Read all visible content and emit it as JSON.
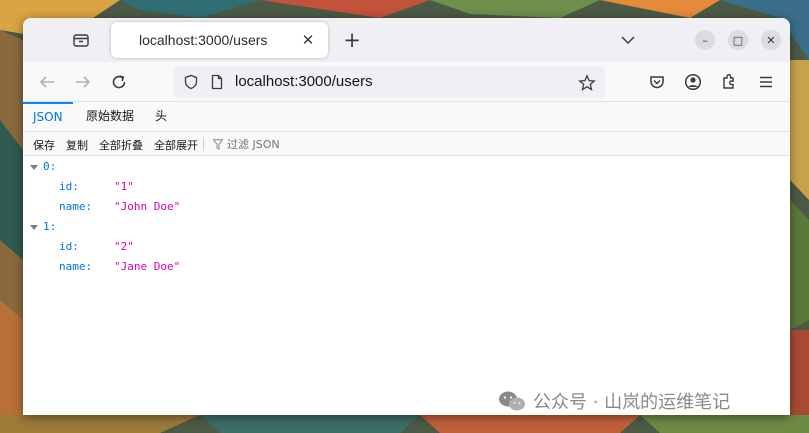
{
  "browser": {
    "tab_title": "localhost:3000/users",
    "new_tab_label": "+",
    "tab_close_label": "✕",
    "url": "localhost:3000/users",
    "window_controls": {
      "minimize": "–",
      "maximize": "□",
      "close": "✕"
    }
  },
  "viewer": {
    "tabs": [
      {
        "label": "JSON",
        "active": true
      },
      {
        "label": "原始数据",
        "active": false
      },
      {
        "label": "头",
        "active": false
      }
    ],
    "toolbar": {
      "save": "保存",
      "copy": "复制",
      "collapse_all": "全部折叠",
      "expand_all": "全部展开",
      "filter_placeholder": "过滤 JSON"
    },
    "tree": [
      {
        "index": "0:",
        "fields": [
          {
            "key": "id:",
            "value": "\"1\""
          },
          {
            "key": "name:",
            "value": "\"John Doe\""
          }
        ]
      },
      {
        "index": "1:",
        "fields": [
          {
            "key": "id:",
            "value": "\"2\""
          },
          {
            "key": "name:",
            "value": "\"Jane Doe\""
          }
        ]
      }
    ]
  },
  "watermark": {
    "text": "公众号 · 山岚的运维笔记"
  },
  "colors": {
    "accent": "#0a84ff",
    "json_key": "#0074e8",
    "json_string": "#dd00a9"
  },
  "icons": {
    "tab_list": "tab-list-icon",
    "back": "back-arrow-icon",
    "forward": "forward-arrow-icon",
    "reload": "reload-icon",
    "shield": "shield-icon",
    "page": "page-icon",
    "bookmark": "star-icon",
    "pocket": "pocket-icon",
    "account": "account-icon",
    "extensions": "puzzle-icon",
    "menu": "hamburger-menu-icon",
    "filter": "funnel-icon"
  }
}
